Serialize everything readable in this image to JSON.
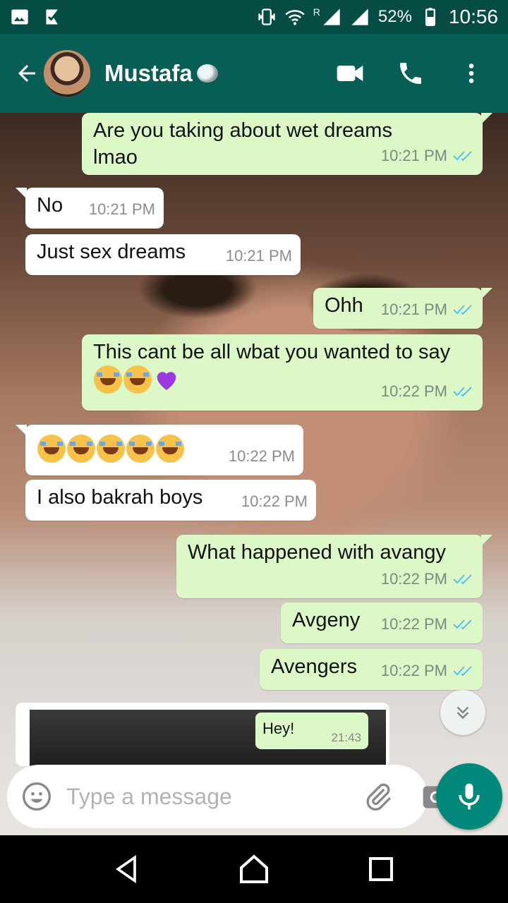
{
  "status_bar": {
    "battery": "52%",
    "time": "10:56",
    "network_label": "R"
  },
  "header": {
    "contact_name": "Mustafa",
    "icons": [
      "back-arrow-icon",
      "video-call-icon",
      "phone-icon",
      "more-vert-icon"
    ]
  },
  "messages": [
    {
      "dir": "out",
      "text": "Are you taking about wet dreams lmao",
      "time": "10:21 PM",
      "read": true
    },
    {
      "dir": "in",
      "text": "No",
      "time": "10:21 PM"
    },
    {
      "dir": "in",
      "text": "Just sex dreams",
      "time": "10:21 PM"
    },
    {
      "dir": "out",
      "text": "Ohh",
      "time": "10:21 PM",
      "read": true
    },
    {
      "dir": "out",
      "text": "This cant be all wbat you wanted to say",
      "emoji": [
        "face-with-tears-of-joy",
        "face-with-tears-of-joy",
        "purple-heart"
      ],
      "time": "10:22 PM",
      "read": true
    },
    {
      "dir": "in",
      "text": "",
      "emoji": [
        "face-with-tears-of-joy",
        "face-with-tears-of-joy",
        "face-with-tears-of-joy",
        "face-with-tears-of-joy",
        "face-with-tears-of-joy"
      ],
      "time": "10:22 PM"
    },
    {
      "dir": "in",
      "text": "I also bakrah boys",
      "time": "10:22 PM"
    },
    {
      "dir": "out",
      "text": "What happened with avangy",
      "time": "10:22 PM",
      "read": true
    },
    {
      "dir": "out",
      "text": "Avgeny",
      "time": "10:22 PM",
      "read": true
    },
    {
      "dir": "out",
      "text": "Avengers",
      "time": "10:22 PM",
      "read": true
    }
  ],
  "media_preview": {
    "bubble_text": "Hey!",
    "bubble_time": "21:43"
  },
  "composer": {
    "placeholder": "Type a message"
  },
  "colors": {
    "header": "#075e54",
    "status_bar": "#054d44",
    "outgoing": "#dcf8c6",
    "incoming": "#ffffff",
    "read_ticks": "#4fc3f7",
    "mic": "#00897b"
  }
}
